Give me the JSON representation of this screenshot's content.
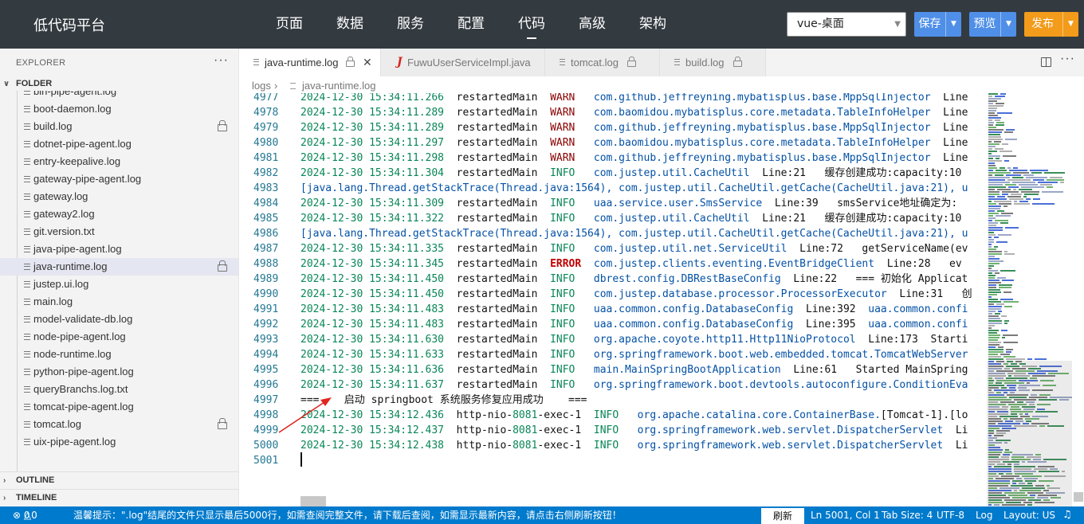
{
  "app": {
    "brand": "低代码平台",
    "nav": [
      "页面",
      "数据",
      "服务",
      "配置",
      "代码",
      "高级",
      "架构"
    ],
    "active_nav": "代码",
    "env_select": "vue-桌面",
    "save": "保存",
    "preview": "预览",
    "publish": "发布",
    "colors": {
      "topbar": "#333a40",
      "primary": "#4f8fe8",
      "publish": "#f39b1b",
      "status": "#007acc"
    }
  },
  "sidebar": {
    "explorer": "EXPLORER",
    "folder": "FOLDER",
    "files": [
      {
        "name": "bin-pipe-agent.log",
        "locked": false,
        "selected": false
      },
      {
        "name": "boot-daemon.log",
        "locked": false,
        "selected": false
      },
      {
        "name": "build.log",
        "locked": true,
        "selected": false
      },
      {
        "name": "dotnet-pipe-agent.log",
        "locked": false,
        "selected": false
      },
      {
        "name": "entry-keepalive.log",
        "locked": false,
        "selected": false
      },
      {
        "name": "gateway-pipe-agent.log",
        "locked": false,
        "selected": false
      },
      {
        "name": "gateway.log",
        "locked": false,
        "selected": false
      },
      {
        "name": "gateway2.log",
        "locked": false,
        "selected": false
      },
      {
        "name": "git.version.txt",
        "locked": false,
        "selected": false
      },
      {
        "name": "java-pipe-agent.log",
        "locked": false,
        "selected": false
      },
      {
        "name": "java-runtime.log",
        "locked": true,
        "selected": true
      },
      {
        "name": "justep.ui.log",
        "locked": false,
        "selected": false
      },
      {
        "name": "main.log",
        "locked": false,
        "selected": false
      },
      {
        "name": "model-validate-db.log",
        "locked": false,
        "selected": false
      },
      {
        "name": "node-pipe-agent.log",
        "locked": false,
        "selected": false
      },
      {
        "name": "node-runtime.log",
        "locked": false,
        "selected": false
      },
      {
        "name": "python-pipe-agent.log",
        "locked": false,
        "selected": false
      },
      {
        "name": "queryBranchs.log.txt",
        "locked": false,
        "selected": false
      },
      {
        "name": "tomcat-pipe-agent.log",
        "locked": false,
        "selected": false
      },
      {
        "name": "tomcat.log",
        "locked": true,
        "selected": false
      },
      {
        "name": "uix-pipe-agent.log",
        "locked": false,
        "selected": false
      }
    ],
    "outline": "OUTLINE",
    "timeline": "TIMELINE"
  },
  "tabs": [
    {
      "label": "java-runtime.log",
      "icon": "file-lines-icon",
      "active": true
    },
    {
      "label": "FuwuUserServiceImpl.java",
      "icon": "java-icon",
      "active": false
    },
    {
      "label": "tomcat.log",
      "icon": "file-lines-icon",
      "active": false
    },
    {
      "label": "build.log",
      "icon": "file-lines-icon",
      "active": false
    }
  ],
  "breadcrumb": {
    "folder": "logs",
    "file": "java-runtime.log"
  },
  "editor": {
    "lines": [
      {
        "n": "4977",
        "parts": [
          [
            "2024-12-30 15:34:11.266",
            "t"
          ],
          [
            "  restartedMain  ",
            "p"
          ],
          [
            "WARN",
            "w"
          ],
          [
            "   ",
            "p"
          ],
          [
            "com.github.jeffreyning.mybatisplus.base.MppSqlInjector",
            "c"
          ],
          [
            "  Line",
            "p"
          ]
        ]
      },
      {
        "n": "4978",
        "parts": [
          [
            "2024-12-30 15:34:11.289",
            "t"
          ],
          [
            "  restartedMain  ",
            "p"
          ],
          [
            "WARN",
            "w"
          ],
          [
            "   ",
            "p"
          ],
          [
            "com.baomidou.mybatisplus.core.metadata.TableInfoHelper",
            "c"
          ],
          [
            "  Line",
            "p"
          ]
        ]
      },
      {
        "n": "4979",
        "parts": [
          [
            "2024-12-30 15:34:11.289",
            "t"
          ],
          [
            "  restartedMain  ",
            "p"
          ],
          [
            "WARN",
            "w"
          ],
          [
            "   ",
            "p"
          ],
          [
            "com.github.jeffreyning.mybatisplus.base.MppSqlInjector",
            "c"
          ],
          [
            "  Line",
            "p"
          ]
        ]
      },
      {
        "n": "4980",
        "parts": [
          [
            "2024-12-30 15:34:11.297",
            "t"
          ],
          [
            "  restartedMain  ",
            "p"
          ],
          [
            "WARN",
            "w"
          ],
          [
            "   ",
            "p"
          ],
          [
            "com.baomidou.mybatisplus.core.metadata.TableInfoHelper",
            "c"
          ],
          [
            "  Line",
            "p"
          ]
        ]
      },
      {
        "n": "4981",
        "parts": [
          [
            "2024-12-30 15:34:11.298",
            "t"
          ],
          [
            "  restartedMain  ",
            "p"
          ],
          [
            "WARN",
            "w"
          ],
          [
            "   ",
            "p"
          ],
          [
            "com.github.jeffreyning.mybatisplus.base.MppSqlInjector",
            "c"
          ],
          [
            "  Line",
            "p"
          ]
        ]
      },
      {
        "n": "4982",
        "parts": [
          [
            "2024-12-30 15:34:11.304",
            "t"
          ],
          [
            "  restartedMain  ",
            "p"
          ],
          [
            "INFO",
            "i"
          ],
          [
            "   ",
            "p"
          ],
          [
            "com.justep.util.CacheUtil",
            "c"
          ],
          [
            "  Line:21   缓存创建成功:capacity:10",
            "p"
          ]
        ]
      },
      {
        "n": "4983",
        "parts": [
          [
            "[java.lang.Thread.getStackTrace(Thread.java:1564), com.justep.util.CacheUtil.getCache(CacheUtil.java:21), u",
            "c"
          ]
        ]
      },
      {
        "n": "4984",
        "parts": [
          [
            "2024-12-30 15:34:11.309",
            "t"
          ],
          [
            "  restartedMain  ",
            "p"
          ],
          [
            "INFO",
            "i"
          ],
          [
            "   ",
            "p"
          ],
          [
            "uaa.service.user.SmsService",
            "c"
          ],
          [
            "  Line:39   smsService地址确定为:",
            "p"
          ]
        ]
      },
      {
        "n": "4985",
        "parts": [
          [
            "2024-12-30 15:34:11.322",
            "t"
          ],
          [
            "  restartedMain  ",
            "p"
          ],
          [
            "INFO",
            "i"
          ],
          [
            "   ",
            "p"
          ],
          [
            "com.justep.util.CacheUtil",
            "c"
          ],
          [
            "  Line:21   缓存创建成功:capacity:10",
            "p"
          ]
        ]
      },
      {
        "n": "4986",
        "parts": [
          [
            "[java.lang.Thread.getStackTrace(Thread.java:1564), com.justep.util.CacheUtil.getCache(CacheUtil.java:21), u",
            "c"
          ]
        ]
      },
      {
        "n": "4987",
        "parts": [
          [
            "2024-12-30 15:34:11.335",
            "t"
          ],
          [
            "  restartedMain  ",
            "p"
          ],
          [
            "INFO",
            "i"
          ],
          [
            "   ",
            "p"
          ],
          [
            "com.justep.util.net.ServiceUtil",
            "c"
          ],
          [
            "  Line:72   getServiceName(ev",
            "p"
          ]
        ]
      },
      {
        "n": "4988",
        "parts": [
          [
            "2024-12-30 15:34:11.345",
            "t"
          ],
          [
            "  restartedMain  ",
            "p"
          ],
          [
            "ERROR",
            "e"
          ],
          [
            "  ",
            "p"
          ],
          [
            "com.justep.clients.eventing.EventBridgeClient",
            "c"
          ],
          [
            "  Line:28   ev",
            "p"
          ]
        ]
      },
      {
        "n": "4989",
        "parts": [
          [
            "2024-12-30 15:34:11.450",
            "t"
          ],
          [
            "  restartedMain  ",
            "p"
          ],
          [
            "INFO",
            "i"
          ],
          [
            "   ",
            "p"
          ],
          [
            "dbrest.config.DBRestBaseConfig",
            "c"
          ],
          [
            "  Line:22   === 初始化 Applicat",
            "p"
          ]
        ]
      },
      {
        "n": "4990",
        "parts": [
          [
            "2024-12-30 15:34:11.450",
            "t"
          ],
          [
            "  restartedMain  ",
            "p"
          ],
          [
            "INFO",
            "i"
          ],
          [
            "   ",
            "p"
          ],
          [
            "com.justep.database.processor.ProcessorExecutor",
            "c"
          ],
          [
            "  Line:31   创",
            "p"
          ]
        ]
      },
      {
        "n": "4991",
        "parts": [
          [
            "2024-12-30 15:34:11.483",
            "t"
          ],
          [
            "  restartedMain  ",
            "p"
          ],
          [
            "INFO",
            "i"
          ],
          [
            "   ",
            "p"
          ],
          [
            "uaa.common.config.DatabaseConfig",
            "c"
          ],
          [
            "  Line:392  ",
            "p"
          ],
          [
            "uaa.common.confi",
            "c"
          ]
        ]
      },
      {
        "n": "4992",
        "parts": [
          [
            "2024-12-30 15:34:11.483",
            "t"
          ],
          [
            "  restartedMain  ",
            "p"
          ],
          [
            "INFO",
            "i"
          ],
          [
            "   ",
            "p"
          ],
          [
            "uaa.common.config.DatabaseConfig",
            "c"
          ],
          [
            "  Line:395  ",
            "p"
          ],
          [
            "uaa.common.confi",
            "c"
          ]
        ]
      },
      {
        "n": "4993",
        "parts": [
          [
            "2024-12-30 15:34:11.630",
            "t"
          ],
          [
            "  restartedMain  ",
            "p"
          ],
          [
            "INFO",
            "i"
          ],
          [
            "   ",
            "p"
          ],
          [
            "org.apache.coyote.http11.Http11NioProtocol",
            "c"
          ],
          [
            "  Line:173  Starti",
            "p"
          ]
        ]
      },
      {
        "n": "4994",
        "parts": [
          [
            "2024-12-30 15:34:11.633",
            "t"
          ],
          [
            "  restartedMain  ",
            "p"
          ],
          [
            "INFO",
            "i"
          ],
          [
            "   ",
            "p"
          ],
          [
            "org.springframework.boot.web.embedded.tomcat.TomcatWebServer",
            "c"
          ]
        ]
      },
      {
        "n": "4995",
        "parts": [
          [
            "2024-12-30 15:34:11.636",
            "t"
          ],
          [
            "  restartedMain  ",
            "p"
          ],
          [
            "INFO",
            "i"
          ],
          [
            "   ",
            "p"
          ],
          [
            "main.MainSpringBootApplication",
            "c"
          ],
          [
            "  Line:61   Started MainSpring",
            "p"
          ]
        ]
      },
      {
        "n": "4996",
        "parts": [
          [
            "2024-12-30 15:34:11.637",
            "t"
          ],
          [
            "  restartedMain  ",
            "p"
          ],
          [
            "INFO",
            "i"
          ],
          [
            "   ",
            "p"
          ],
          [
            "org.springframework.boot.devtools.autoconfigure.ConditionEva",
            "c"
          ]
        ]
      },
      {
        "n": "4997",
        "parts": [
          [
            "===    启动 springboot 系统服务修复应用成功    ===",
            "p"
          ]
        ]
      },
      {
        "n": "4998",
        "parts": [
          [
            "2024-12-30 15:34:12.436",
            "t"
          ],
          [
            "  http-nio-",
            "p"
          ],
          [
            "8081",
            "t"
          ],
          [
            "-exec-1  ",
            "p"
          ],
          [
            "INFO",
            "i"
          ],
          [
            "   ",
            "p"
          ],
          [
            "org.apache.catalina.core.ContainerBase.",
            "c"
          ],
          [
            "[Tomcat-1].[lo",
            "p"
          ]
        ]
      },
      {
        "n": "4999",
        "parts": [
          [
            "2024-12-30 15:34:12.437",
            "t"
          ],
          [
            "  http-nio-",
            "p"
          ],
          [
            "8081",
            "t"
          ],
          [
            "-exec-1  ",
            "p"
          ],
          [
            "INFO",
            "i"
          ],
          [
            "   ",
            "p"
          ],
          [
            "org.springframework.web.servlet.DispatcherServlet",
            "c"
          ],
          [
            "  Li",
            "p"
          ]
        ]
      },
      {
        "n": "5000",
        "parts": [
          [
            "2024-12-30 15:34:12.438",
            "t"
          ],
          [
            "  http-nio-",
            "p"
          ],
          [
            "8081",
            "t"
          ],
          [
            "-exec-1  ",
            "p"
          ],
          [
            "INFO",
            "i"
          ],
          [
            "   ",
            "p"
          ],
          [
            "org.springframework.web.servlet.DispatcherServlet",
            "c"
          ],
          [
            "  Li",
            "p"
          ]
        ]
      },
      {
        "n": "5001",
        "parts": []
      }
    ]
  },
  "status": {
    "problems": "0",
    "warnings": "0",
    "hint": "温馨提示：\".log\"结尾的文件只显示最后5000行，如需查阅完整文件，请下载后查阅，如需显示最新内容，请点击右侧刷新按钮！",
    "refresh": "刷新",
    "position": "Ln 5001, Col 1",
    "tab_size": "Tab Size: 4",
    "encoding": "UTF-8",
    "language": "Log",
    "layout": "Layout: US"
  }
}
